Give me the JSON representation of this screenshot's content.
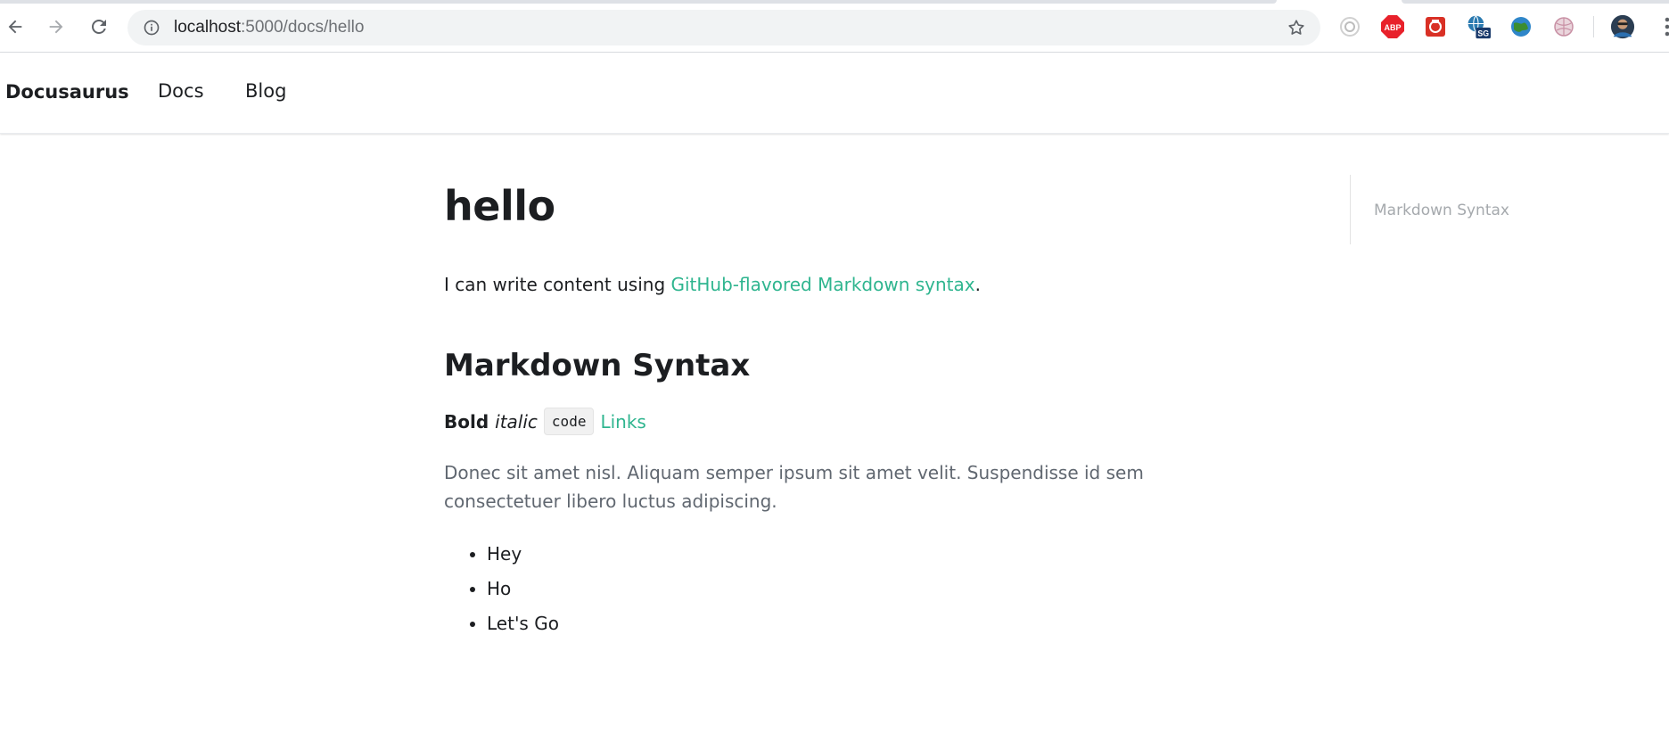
{
  "browser": {
    "url_host": "localhost",
    "url_path": ":5000/docs/hello",
    "extensions": [
      {
        "name": "spinner-extension-icon",
        "color": "#bdbdbd"
      },
      {
        "name": "adblock-plus-icon",
        "label": "ABP",
        "color": "#e8212b"
      },
      {
        "name": "image-extension-icon",
        "color": "#d93025"
      },
      {
        "name": "globe-sg-extension-icon",
        "label": "SG",
        "color": "#1a3a6b"
      },
      {
        "name": "globe-extension-icon",
        "color": "#3c8d2f"
      },
      {
        "name": "ball-extension-icon",
        "color": "#d8a0b0"
      },
      {
        "name": "profile-avatar-icon",
        "color": "#2b3d52"
      }
    ]
  },
  "navbar": {
    "brand": "Docusaurus",
    "links": [
      "Docs",
      "Blog"
    ]
  },
  "article": {
    "title": "hello",
    "intro_prefix": "I can write content using ",
    "intro_link": "GitHub-flavored Markdown syntax",
    "intro_suffix": ".",
    "section_title": "Markdown Syntax",
    "inline": {
      "bold": "Bold",
      "italic": "italic",
      "code": "code",
      "link": "Links"
    },
    "paragraph": "Donec sit amet nisl. Aliquam semper ipsum sit amet velit. Suspendisse id sem consectetuer libero luctus adipiscing.",
    "list": [
      "Hey",
      "Ho",
      "Let's Go"
    ]
  },
  "toc": {
    "items": [
      "Markdown Syntax"
    ]
  },
  "colors": {
    "link": "#2fb58f",
    "text": "#1c1e21",
    "muted": "#606770"
  }
}
